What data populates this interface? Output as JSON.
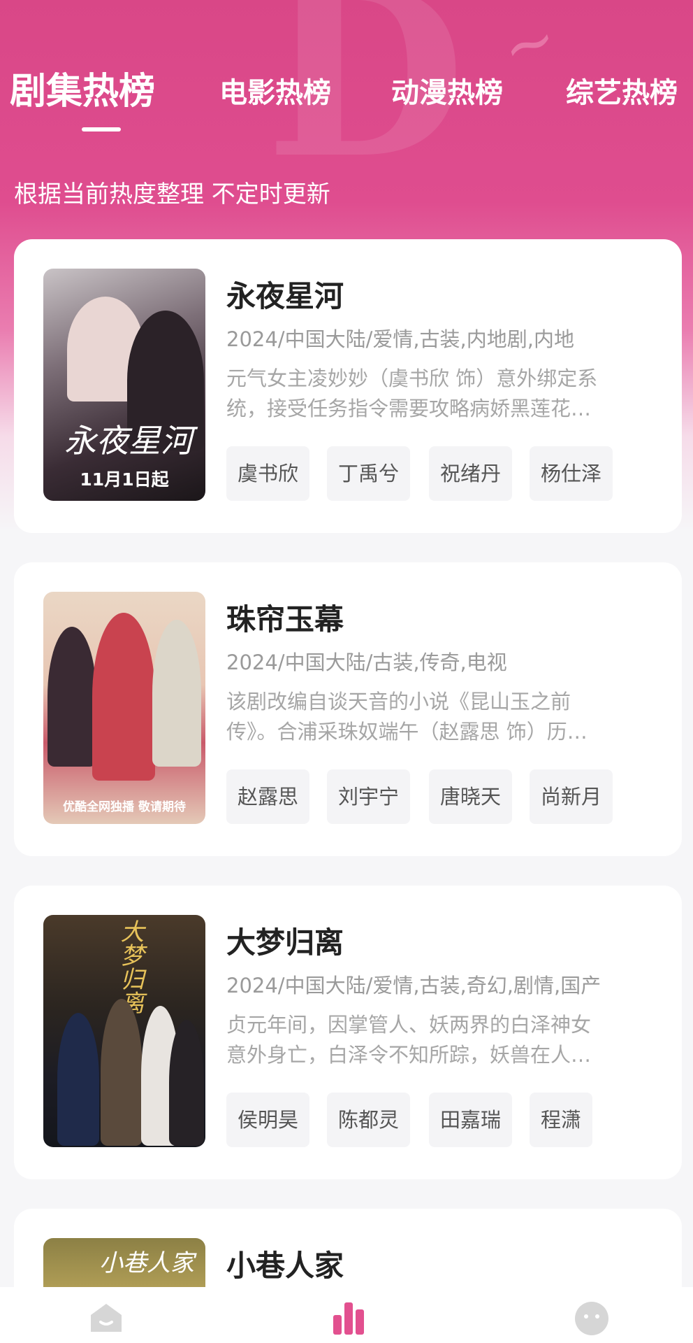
{
  "tabs": [
    "剧集热榜",
    "电影热榜",
    "动漫热榜",
    "综艺热榜"
  ],
  "active_tab": "剧集热榜",
  "subtitle": "根据当前热度整理 不定时更新",
  "cards": [
    {
      "title": "永夜星河",
      "meta": "2024/中国大陆/爱情,古装,内地剧,内地",
      "desc_lines": [
        "元气女主凌妙妙（虞书欣 饰）意外绑定系",
        "统，接受任务指令需要攻略病娇黑莲花…"
      ],
      "tags": [
        "虞书欣",
        "丁禹兮",
        "祝绪丹",
        "杨仕泽"
      ],
      "poster_caption": "11月1日起",
      "poster_calligraphy": "永夜星河"
    },
    {
      "title": "珠帘玉幕",
      "meta": "2024/中国大陆/古装,传奇,电视",
      "desc_lines": [
        "该剧改编自谈天音的小说《昆山玉之前",
        "传》。合浦采珠奴端午（赵露思 饰）历…"
      ],
      "tags": [
        "赵露思",
        "刘宇宁",
        "唐晓天",
        "尚新月"
      ],
      "poster_caption": "优酷全网独播 敬请期待",
      "poster_calligraphy": ""
    },
    {
      "title": "大梦归离",
      "meta": "2024/中国大陆/爱情,古装,奇幻,剧情,国产",
      "desc_lines": [
        "贞元年间，因掌管人、妖两界的白泽神女",
        "意外身亡，白泽令不知所踪，妖兽在人…"
      ],
      "tags": [
        "侯明昊",
        "陈都灵",
        "田嘉瑞",
        "程潇"
      ],
      "poster_caption": "",
      "poster_calligraphy": "大梦归离"
    },
    {
      "title": "小巷人家",
      "meta": "",
      "desc_lines": [],
      "tags": [],
      "poster_caption": "",
      "poster_calligraphy": "小巷人家"
    }
  ],
  "bottom_nav": [
    "home-icon",
    "rank-chart-icon",
    "profile-face-icon"
  ],
  "colors": {
    "brand_pink": "#df4d8f",
    "active_nav": "#e2508f",
    "inactive_nav": "#d6d6d6"
  }
}
